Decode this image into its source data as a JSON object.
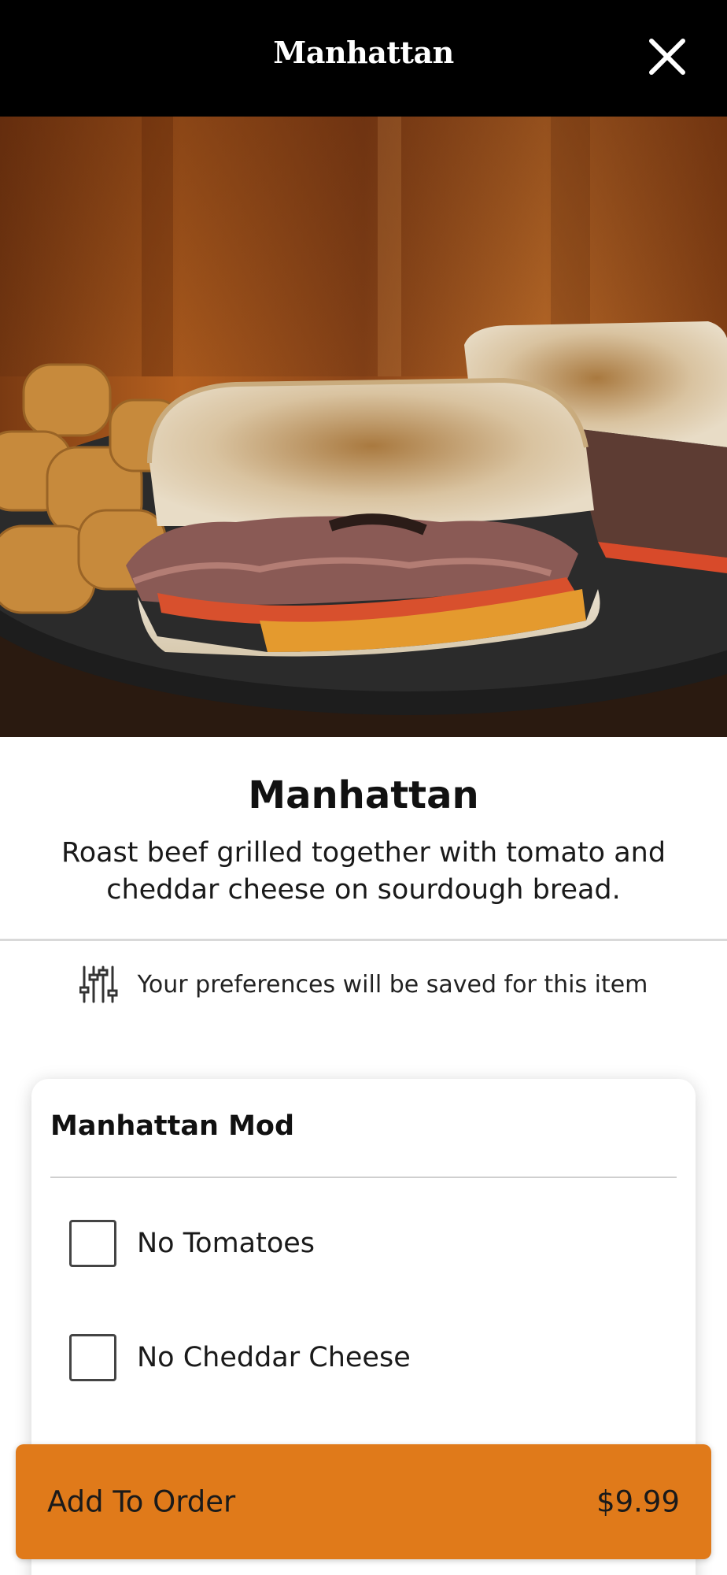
{
  "header": {
    "title": "Manhattan",
    "close_icon": "close-icon"
  },
  "photo": {
    "subject": "sandwich-photo"
  },
  "item": {
    "name": "Manhattan",
    "description": "Roast beef grilled together with tomato and cheddar cheese on sourdough bread."
  },
  "preferences": {
    "icon": "sliders-icon",
    "text": "Your preferences will be saved for this item"
  },
  "modifiers": {
    "title": "Manhattan Mod",
    "options": [
      {
        "label": "No Tomatoes",
        "checked": false
      },
      {
        "label": "No Cheddar Cheese",
        "checked": false
      }
    ]
  },
  "cta": {
    "label": "Add To Order",
    "price": "$9.99"
  },
  "colors": {
    "header_bg": "#000000",
    "accent": "#e07a1a"
  }
}
